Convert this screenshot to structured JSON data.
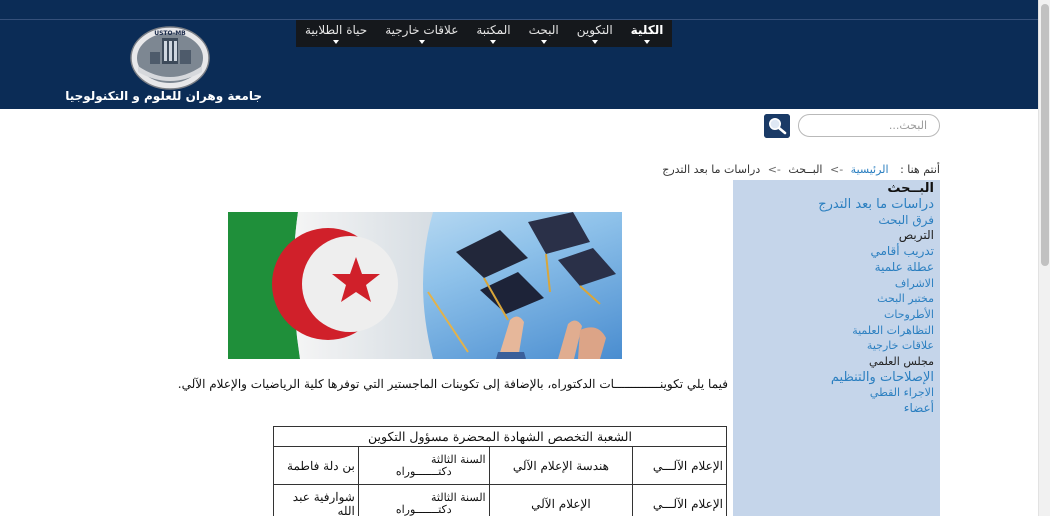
{
  "nav": {
    "items": [
      {
        "label": "الكلية",
        "active": true
      },
      {
        "label": "التكوين",
        "active": false
      },
      {
        "label": "البحث",
        "active": false
      },
      {
        "label": "المكتبة",
        "active": false
      },
      {
        "label": "علاقات خارجية",
        "active": false
      },
      {
        "label": "حياة الطلابية",
        "active": false
      }
    ]
  },
  "logo": {
    "emblem_text": "USTO-MB",
    "name": "جامعة وهران للعلوم و التكنولوجيا"
  },
  "search": {
    "placeholder": "البحث...",
    "icon": "magnifier-icon"
  },
  "breadcrumb": {
    "prefix": "أنتم هنا :",
    "items": [
      "الرئيسية",
      "البــحث",
      "دراسات ما بعد التدرج"
    ],
    "separator": "->"
  },
  "sidebar": {
    "title": "البــحث",
    "items": [
      {
        "label": "دراسات ما بعد التدرج",
        "link": true,
        "size": 13
      },
      {
        "label": "فرق البحث",
        "link": true,
        "size": 12
      },
      {
        "label": "التربص",
        "link": false,
        "size": 12
      },
      {
        "label": "تدريب أقامي",
        "link": true,
        "size": 12
      },
      {
        "label": "عطلة علمية",
        "link": true,
        "size": 12
      },
      {
        "label": "الاشراف",
        "link": true,
        "size": 11
      },
      {
        "label": "مختبر البحث",
        "link": true,
        "size": 11
      },
      {
        "label": "الأطروحات",
        "link": true,
        "size": 11
      },
      {
        "label": "التظاهرات العلمية",
        "link": true,
        "size": 11
      },
      {
        "label": "علاقات خارجية",
        "link": true,
        "size": 11
      },
      {
        "label": "مجلس العلمي",
        "link": false,
        "size": 11
      },
      {
        "label": "الإصلاحات والتنظيم",
        "link": true,
        "size": 13
      },
      {
        "label": "الاجراء القطي",
        "link": true,
        "size": 11
      },
      {
        "label": "أعضاء",
        "link": true,
        "size": 12
      }
    ]
  },
  "content": {
    "intro": "فيما يلي تكوينـــــــــــــات الدكتوراه، بالإضافة إلى تكوينات الماجستير التي توفرها كلية الرياضيات والإعلام الآلي.",
    "table": {
      "header": "الشعبة التخصص الشهادة المحضرة مسؤول التكوين",
      "rows": [
        {
          "field": "الإعلام الآلـــي",
          "specialty": "هندسة الإعلام الآلي",
          "degree_year": "السنة الثالثة",
          "degree_name": "دكتـــــــوراه",
          "responsible": "بن دلة فاطمة"
        },
        {
          "field": "الإعلام الآلـــي",
          "specialty": "الإعلام الآلي",
          "degree_year": "السنة الثالثة",
          "degree_name": "دكتـــــــوراه",
          "responsible": "شوارفية عبد الله"
        }
      ]
    }
  },
  "colors": {
    "header_bg": "#0b2c56",
    "nav_bg": "#15181c",
    "sidebar_bg": "#c5d5ea",
    "link": "#2b7fc0"
  }
}
